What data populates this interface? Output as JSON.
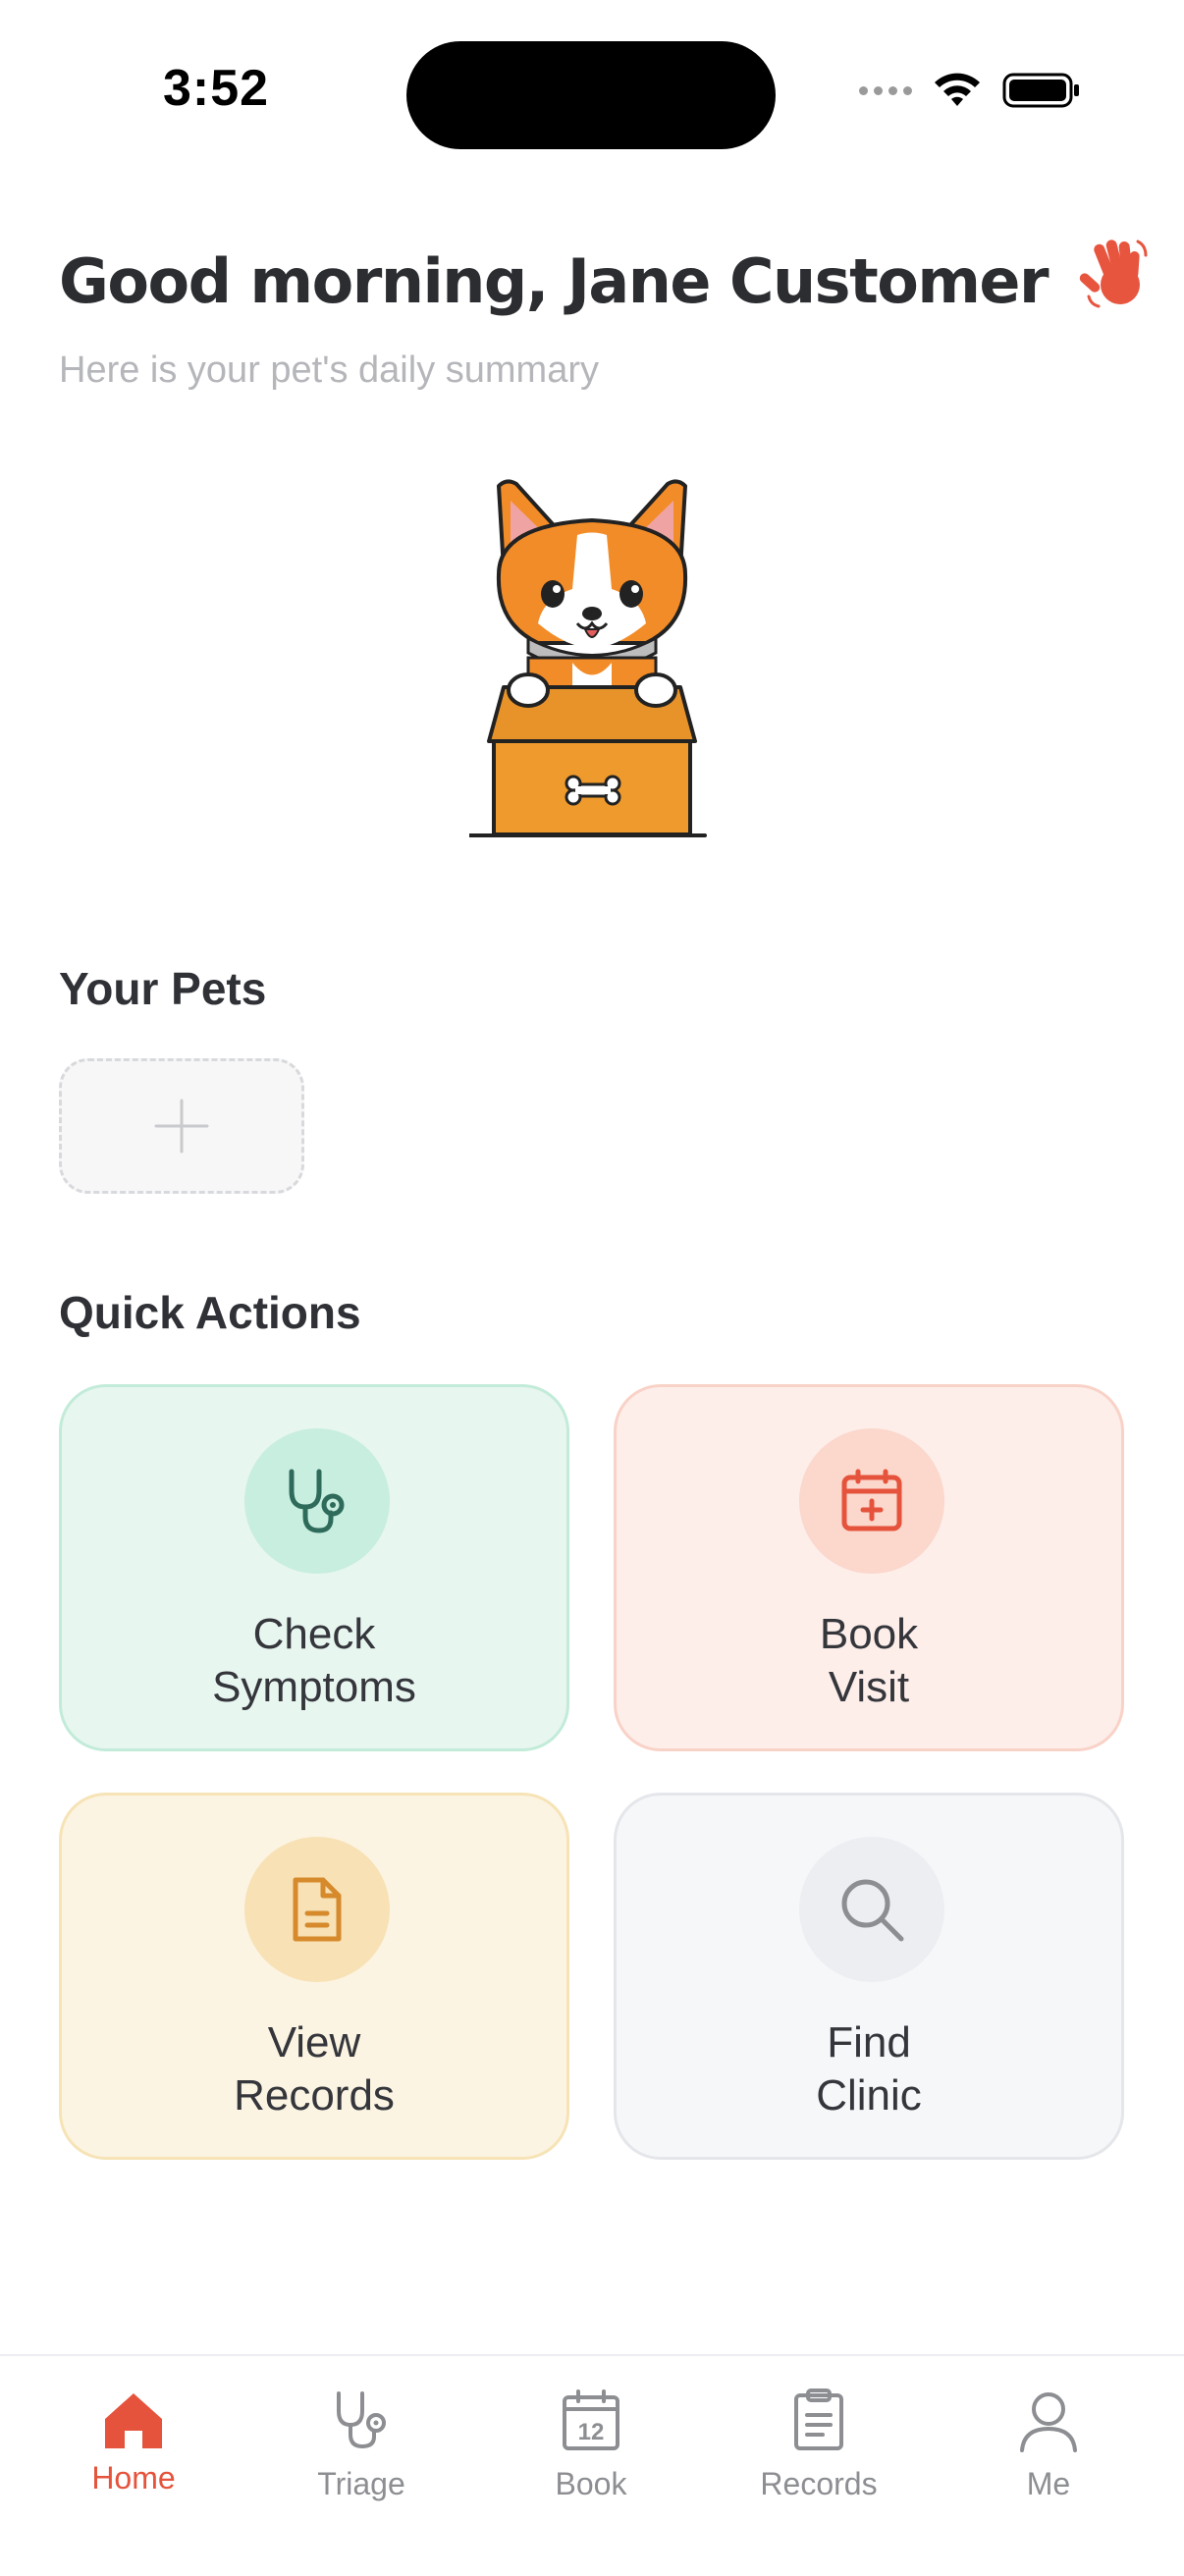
{
  "status_bar": {
    "time": "3:52"
  },
  "greeting": {
    "title": "Good morning, Jane Customer",
    "subtitle": "Here is your pet's daily summary",
    "emoji_icon": "waving-hand-icon"
  },
  "pets": {
    "title": "Your Pets",
    "add_icon": "plus-icon"
  },
  "quick_actions": {
    "title": "Quick Actions",
    "cards": [
      {
        "line1": "Check",
        "line2": "Symptoms",
        "icon": "stethoscope-icon",
        "accent": "#2f6b5a"
      },
      {
        "line1": "Book",
        "line2": "Visit",
        "icon": "calendar-plus-icon",
        "accent": "#e5533c"
      },
      {
        "line1": "View",
        "line2": "Records",
        "icon": "document-icon",
        "accent": "#d68a2c"
      },
      {
        "line1": "Find",
        "line2": "Clinic",
        "icon": "search-icon",
        "accent": "#8c8e92"
      }
    ]
  },
  "tab_bar": {
    "items": [
      {
        "label": "Home",
        "icon": "home-icon",
        "active": true
      },
      {
        "label": "Triage",
        "icon": "stethoscope-icon",
        "active": false
      },
      {
        "label": "Book",
        "icon": "calendar-icon",
        "active": false
      },
      {
        "label": "Records",
        "icon": "clipboard-icon",
        "active": false
      },
      {
        "label": "Me",
        "icon": "person-icon",
        "active": false
      }
    ],
    "calendar_day": "12"
  },
  "colors": {
    "brand": "#e5533c",
    "inactive": "#8c8e92"
  }
}
